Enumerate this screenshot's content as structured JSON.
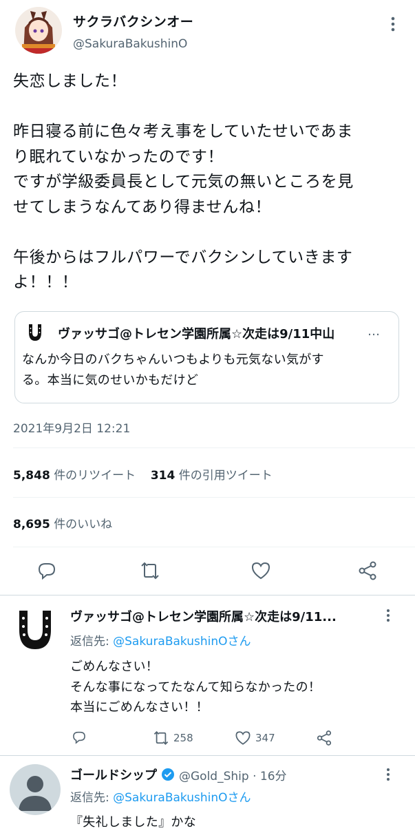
{
  "tweet": {
    "display_name": "サクラバクシンオー",
    "handle": "@SakuraBakushinO",
    "body": "失恋しました！\n\n昨日寝る前に色々考え事をしていたせいであま\nり眠れていなかったのです！\nですが学級委員長として元気の無いところを見\nせてしまうなんてあり得ませんね！\n\n午後からはフルパワーでバクシンしていきます\nよ！！！",
    "timestamp": "2021年9月2日 12:21",
    "retweets": "5,848",
    "retweets_label": "件のリツイート",
    "quotes": "314",
    "quotes_label": "件の引用ツイート",
    "likes": "8,695",
    "likes_label": "件のいいね"
  },
  "quoted": {
    "name": "ヴァッサゴ@トレセン学園所属☆次走は9/11中山",
    "ellipsis": "…",
    "text": "なんか今日のバクちゃんいつもよりも元気ない気がす\nる。本当に気のせいかもだけど"
  },
  "replies": [
    {
      "name": "ヴァッサゴ@トレセン学園所属☆次走は9/11...",
      "replying_prefix": "返信先: ",
      "replying_to": "@SakuraBakushinOさん",
      "text": "ごめんなさい！\nそんな事になってたなんて知らなかったの！\n本当にごめんなさい！！",
      "retweets": "258",
      "likes": "347"
    },
    {
      "name": "ゴールドシップ",
      "handle_time": "@Gold_Ship · 16分",
      "replying_prefix": "返信先: ",
      "replying_to": "@SakuraBakushinOさん",
      "text": "『失礼しました』かな"
    }
  ],
  "icons": [
    "more-vertical-icon",
    "reply-icon",
    "retweet-icon",
    "like-icon",
    "share-icon",
    "horseshoe-icon",
    "verified-icon",
    "default-avatar-icon"
  ],
  "colors": {
    "accent": "#1d9bf0",
    "secondary": "#536471",
    "divider": "#eff3f4"
  }
}
